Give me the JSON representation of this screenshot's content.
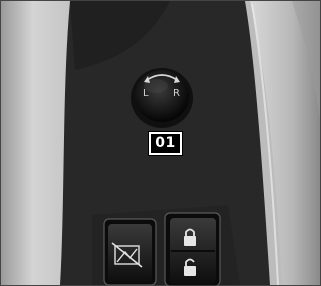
{
  "callout": {
    "label": "01"
  },
  "mirror_knob": {
    "left_label": "L",
    "right_label": "R"
  },
  "icons": {
    "knob_arrows": "curved-arrows-icon",
    "window_lock": "window-lock-icon",
    "lock": "lock-icon",
    "unlock": "unlock-icon"
  },
  "colors": {
    "panel": "#2a2a2a",
    "trim": "#c8c8c8",
    "callout_bg": "#000000",
    "callout_text": "#ffffff"
  }
}
